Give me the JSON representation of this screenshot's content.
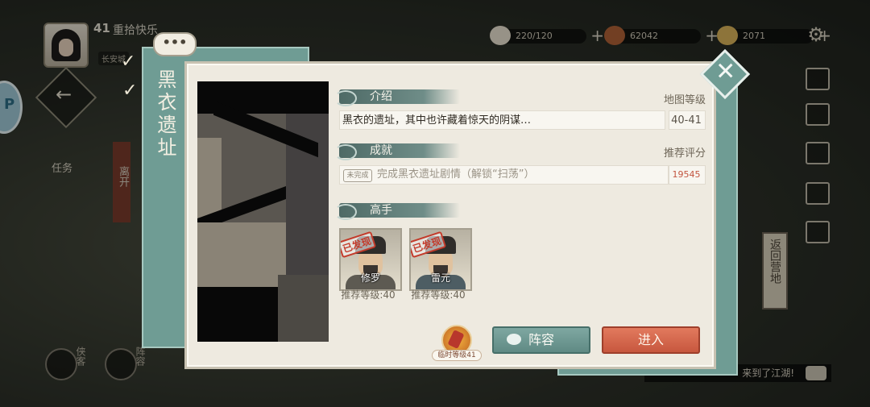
{
  "hud": {
    "level": "41",
    "player_name": "重拾快乐",
    "location_tag": "长安城",
    "stamina": "220/120",
    "silver": "62042",
    "gold": "2071"
  },
  "left_menu": {
    "task_label": "任务",
    "leave_label": "离开"
  },
  "bottom_nav": {
    "hero_label": "侠客",
    "team_label": "阵容"
  },
  "right_side": {
    "return_camp_label": "返回营地",
    "chat_message": "来到了江湖!"
  },
  "dialog": {
    "title": "黑衣遗址",
    "bubble": "•••",
    "intro_header": "介绍",
    "intro_text": "黑衣的遗址，其中也许藏着惊天的阴谋…",
    "map_level_label": "地图等级",
    "map_level_value": "40-41",
    "achievement_header": "成就",
    "achievement_badge": "未完成",
    "achievement_text": "完成黑衣遗址剧情（解锁“扫荡”）",
    "recommended_score_label": "推荐评分",
    "recommended_score_value": "19545",
    "masters_header": "高手",
    "masters": [
      {
        "name": "修罗",
        "found_label": "已发现",
        "recommended_level": "推荐等级:40"
      },
      {
        "name": "雷元",
        "found_label": "已发现",
        "recommended_level": "推荐等级:40"
      }
    ],
    "temp_item_label": "临时等级41",
    "team_button": "阵容",
    "enter_button": "进入"
  },
  "colors": {
    "teal": "#6f9c94",
    "enter_red": "#d0654a",
    "score_red": "#c2543f",
    "paper": "#eeeae0"
  }
}
